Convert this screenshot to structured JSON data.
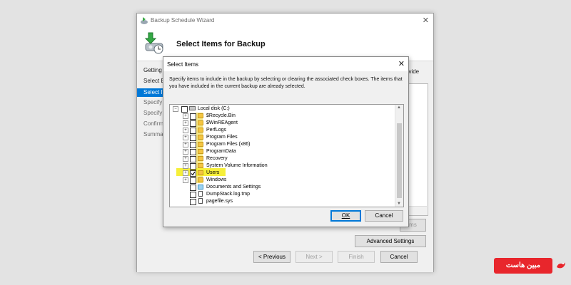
{
  "wizard": {
    "title": "Backup Schedule Wizard",
    "header_title": "Select Items for Backup",
    "nav": [
      {
        "label": "Getting S"
      },
      {
        "label": "Select Ba"
      },
      {
        "label": "Select Ite"
      },
      {
        "label": "Specify B"
      },
      {
        "label": "Specify D"
      },
      {
        "label": "Confirm"
      },
      {
        "label": "Summar"
      }
    ],
    "right_text": "ovide",
    "partial_button": "ms",
    "advanced_button": "Advanced Settings",
    "buttons": {
      "previous": "< Previous",
      "next": "Next >",
      "finish": "Finish",
      "cancel": "Cancel"
    }
  },
  "dialog": {
    "title": "Select Items",
    "description": "Specify items to include in the backup by selecting or clearing the associated check boxes. The items that you have included in the current backup are already selected.",
    "tree": {
      "root": "Local disk (C:)",
      "items": [
        {
          "label": "$Recycle.Bin",
          "type": "folder",
          "checked": false
        },
        {
          "label": "$WinREAgent",
          "type": "folder",
          "checked": false
        },
        {
          "label": "PerfLogs",
          "type": "folder",
          "checked": false
        },
        {
          "label": "Program Files",
          "type": "folder",
          "checked": false
        },
        {
          "label": "Program Files (x86)",
          "type": "folder",
          "checked": false
        },
        {
          "label": "ProgramData",
          "type": "folder",
          "checked": false
        },
        {
          "label": "Recovery",
          "type": "folder",
          "checked": false
        },
        {
          "label": "System Volume Information",
          "type": "folder",
          "checked": false
        },
        {
          "label": "Users",
          "type": "folder",
          "checked": true
        },
        {
          "label": "Windows",
          "type": "folder",
          "checked": false
        },
        {
          "label": "Documents and Settings",
          "type": "shortcut",
          "checked": false
        },
        {
          "label": "DumpStack.log.tmp",
          "type": "file",
          "checked": false
        },
        {
          "label": "pagefile.sys",
          "type": "file",
          "checked": false
        }
      ]
    },
    "ok_label": "OK",
    "cancel_label": "Cancel"
  },
  "watermark": {
    "text": "مبین هاست"
  },
  "colors": {
    "selection": "#0078d7",
    "highlight": "#f6ef3a",
    "watermark": "#e8262c"
  }
}
